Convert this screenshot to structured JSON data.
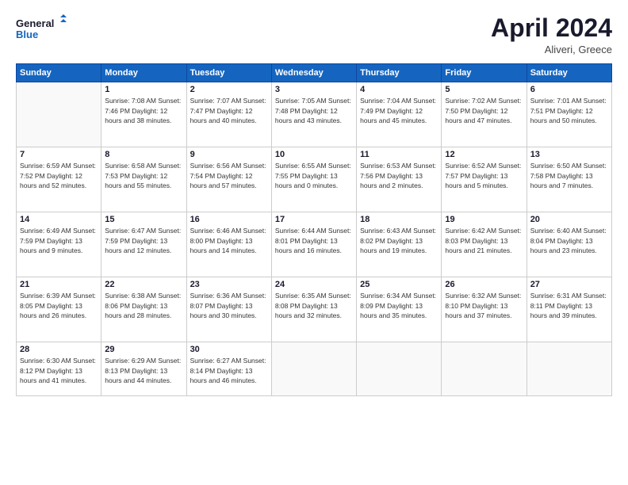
{
  "header": {
    "logo_line1": "General",
    "logo_line2": "Blue",
    "month": "April 2024",
    "location": "Aliveri, Greece"
  },
  "days_of_week": [
    "Sunday",
    "Monday",
    "Tuesday",
    "Wednesday",
    "Thursday",
    "Friday",
    "Saturday"
  ],
  "weeks": [
    [
      {
        "day": "",
        "info": ""
      },
      {
        "day": "1",
        "info": "Sunrise: 7:08 AM\nSunset: 7:46 PM\nDaylight: 12 hours\nand 38 minutes."
      },
      {
        "day": "2",
        "info": "Sunrise: 7:07 AM\nSunset: 7:47 PM\nDaylight: 12 hours\nand 40 minutes."
      },
      {
        "day": "3",
        "info": "Sunrise: 7:05 AM\nSunset: 7:48 PM\nDaylight: 12 hours\nand 43 minutes."
      },
      {
        "day": "4",
        "info": "Sunrise: 7:04 AM\nSunset: 7:49 PM\nDaylight: 12 hours\nand 45 minutes."
      },
      {
        "day": "5",
        "info": "Sunrise: 7:02 AM\nSunset: 7:50 PM\nDaylight: 12 hours\nand 47 minutes."
      },
      {
        "day": "6",
        "info": "Sunrise: 7:01 AM\nSunset: 7:51 PM\nDaylight: 12 hours\nand 50 minutes."
      }
    ],
    [
      {
        "day": "7",
        "info": "Sunrise: 6:59 AM\nSunset: 7:52 PM\nDaylight: 12 hours\nand 52 minutes."
      },
      {
        "day": "8",
        "info": "Sunrise: 6:58 AM\nSunset: 7:53 PM\nDaylight: 12 hours\nand 55 minutes."
      },
      {
        "day": "9",
        "info": "Sunrise: 6:56 AM\nSunset: 7:54 PM\nDaylight: 12 hours\nand 57 minutes."
      },
      {
        "day": "10",
        "info": "Sunrise: 6:55 AM\nSunset: 7:55 PM\nDaylight: 13 hours\nand 0 minutes."
      },
      {
        "day": "11",
        "info": "Sunrise: 6:53 AM\nSunset: 7:56 PM\nDaylight: 13 hours\nand 2 minutes."
      },
      {
        "day": "12",
        "info": "Sunrise: 6:52 AM\nSunset: 7:57 PM\nDaylight: 13 hours\nand 5 minutes."
      },
      {
        "day": "13",
        "info": "Sunrise: 6:50 AM\nSunset: 7:58 PM\nDaylight: 13 hours\nand 7 minutes."
      }
    ],
    [
      {
        "day": "14",
        "info": "Sunrise: 6:49 AM\nSunset: 7:59 PM\nDaylight: 13 hours\nand 9 minutes."
      },
      {
        "day": "15",
        "info": "Sunrise: 6:47 AM\nSunset: 7:59 PM\nDaylight: 13 hours\nand 12 minutes."
      },
      {
        "day": "16",
        "info": "Sunrise: 6:46 AM\nSunset: 8:00 PM\nDaylight: 13 hours\nand 14 minutes."
      },
      {
        "day": "17",
        "info": "Sunrise: 6:44 AM\nSunset: 8:01 PM\nDaylight: 13 hours\nand 16 minutes."
      },
      {
        "day": "18",
        "info": "Sunrise: 6:43 AM\nSunset: 8:02 PM\nDaylight: 13 hours\nand 19 minutes."
      },
      {
        "day": "19",
        "info": "Sunrise: 6:42 AM\nSunset: 8:03 PM\nDaylight: 13 hours\nand 21 minutes."
      },
      {
        "day": "20",
        "info": "Sunrise: 6:40 AM\nSunset: 8:04 PM\nDaylight: 13 hours\nand 23 minutes."
      }
    ],
    [
      {
        "day": "21",
        "info": "Sunrise: 6:39 AM\nSunset: 8:05 PM\nDaylight: 13 hours\nand 26 minutes."
      },
      {
        "day": "22",
        "info": "Sunrise: 6:38 AM\nSunset: 8:06 PM\nDaylight: 13 hours\nand 28 minutes."
      },
      {
        "day": "23",
        "info": "Sunrise: 6:36 AM\nSunset: 8:07 PM\nDaylight: 13 hours\nand 30 minutes."
      },
      {
        "day": "24",
        "info": "Sunrise: 6:35 AM\nSunset: 8:08 PM\nDaylight: 13 hours\nand 32 minutes."
      },
      {
        "day": "25",
        "info": "Sunrise: 6:34 AM\nSunset: 8:09 PM\nDaylight: 13 hours\nand 35 minutes."
      },
      {
        "day": "26",
        "info": "Sunrise: 6:32 AM\nSunset: 8:10 PM\nDaylight: 13 hours\nand 37 minutes."
      },
      {
        "day": "27",
        "info": "Sunrise: 6:31 AM\nSunset: 8:11 PM\nDaylight: 13 hours\nand 39 minutes."
      }
    ],
    [
      {
        "day": "28",
        "info": "Sunrise: 6:30 AM\nSunset: 8:12 PM\nDaylight: 13 hours\nand 41 minutes."
      },
      {
        "day": "29",
        "info": "Sunrise: 6:29 AM\nSunset: 8:13 PM\nDaylight: 13 hours\nand 44 minutes."
      },
      {
        "day": "30",
        "info": "Sunrise: 6:27 AM\nSunset: 8:14 PM\nDaylight: 13 hours\nand 46 minutes."
      },
      {
        "day": "",
        "info": ""
      },
      {
        "day": "",
        "info": ""
      },
      {
        "day": "",
        "info": ""
      },
      {
        "day": "",
        "info": ""
      }
    ]
  ]
}
